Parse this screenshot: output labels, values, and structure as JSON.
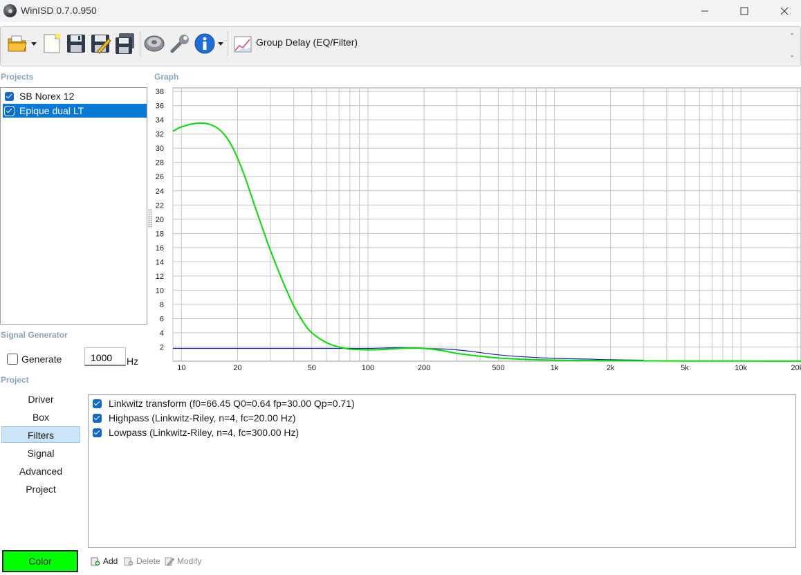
{
  "window": {
    "title": "WinISD 0.7.0.950",
    "controls": {
      "minimize": "—",
      "maximize": "☐",
      "close": "✕"
    }
  },
  "toolbar": {
    "icons": [
      "open-folder-icon",
      "new-document-icon",
      "save-icon",
      "save-as-icon",
      "save-all-icon",
      "driver-speaker-icon",
      "tools-wrench-icon",
      "info-icon"
    ],
    "graph_selector": {
      "label": "Group Delay (EQ/Filter)",
      "icon": "graph-chart-icon"
    },
    "dashes": [
      "-",
      "-"
    ]
  },
  "sections": {
    "projects": "Projects",
    "graph": "Graph",
    "signal_generator": "Signal Generator",
    "project": "Project"
  },
  "projects": [
    {
      "label": "SB Norex 12",
      "checked": true,
      "selected": false
    },
    {
      "label": "Epique dual LT",
      "checked": true,
      "selected": true
    }
  ],
  "signal_generator": {
    "generate_label": "Generate",
    "checked": false,
    "frequency": "1000",
    "unit": "Hz"
  },
  "nav": [
    {
      "label": "Driver",
      "active": false
    },
    {
      "label": "Box",
      "active": false
    },
    {
      "label": "Filters",
      "active": true
    },
    {
      "label": "Signal",
      "active": false
    },
    {
      "label": "Advanced",
      "active": false
    },
    {
      "label": "Project",
      "active": false
    }
  ],
  "color_button": {
    "label": "Color",
    "color": "#00ff00"
  },
  "filters": [
    {
      "label": "Linkwitz transform (f0=66.45 Q0=0.64 fp=30.00 Qp=0.71)",
      "checked": true
    },
    {
      "label": "Highpass (Linkwitz-Riley, n=4, fc=20.00 Hz)",
      "checked": true
    },
    {
      "label": "Lowpass (Linkwitz-Riley, n=4, fc=300.00 Hz)",
      "checked": true
    }
  ],
  "actions": [
    {
      "label": "Add",
      "enabled": true
    },
    {
      "label": "Delete",
      "enabled": false
    },
    {
      "label": "Modify",
      "enabled": false
    }
  ],
  "chart_data": {
    "type": "line",
    "title": "",
    "xlabel": "",
    "ylabel": "",
    "xscale": "log",
    "xlim": [
      9,
      21000
    ],
    "ylim": [
      0,
      38.5
    ],
    "grid": true,
    "legend": "none",
    "yticks": [
      2,
      4,
      6,
      8,
      10,
      12,
      14,
      16,
      18,
      20,
      22,
      24,
      26,
      28,
      30,
      32,
      34,
      36,
      38
    ],
    "xticks": [
      {
        "value": 10,
        "label": "10"
      },
      {
        "value": 20,
        "label": "20"
      },
      {
        "value": 50,
        "label": "50"
      },
      {
        "value": 100,
        "label": "100"
      },
      {
        "value": 200,
        "label": "200"
      },
      {
        "value": 500,
        "label": "500"
      },
      {
        "value": 1000,
        "label": "1k"
      },
      {
        "value": 2000,
        "label": "2k"
      },
      {
        "value": 5000,
        "label": "5k"
      },
      {
        "value": 10000,
        "label": "10k"
      },
      {
        "value": 20000,
        "label": "20k"
      }
    ],
    "series": [
      {
        "color": "#1a1ab4",
        "x": [
          9,
          20,
          40,
          60,
          80,
          100,
          150,
          200,
          300,
          500,
          700,
          1000,
          1500,
          2000,
          3000
        ],
        "y": [
          1.8,
          1.8,
          1.8,
          1.8,
          1.8,
          1.8,
          1.9,
          1.8,
          1.6,
          0.9,
          0.6,
          0.4,
          0.3,
          0.2,
          0.15
        ]
      },
      {
        "color": "#00e000",
        "x": [
          9,
          10,
          12,
          14,
          16,
          18,
          20,
          22,
          25,
          28,
          30,
          35,
          40,
          45,
          50,
          60,
          70,
          80,
          90,
          100,
          120,
          150,
          180,
          200,
          250,
          300,
          400,
          500,
          700,
          1000,
          2000,
          5000,
          10000,
          21000
        ],
        "y": [
          32.4,
          33.0,
          33.5,
          33.4,
          32.6,
          31.0,
          28.6,
          25.8,
          21.5,
          17.8,
          15.6,
          11.2,
          7.8,
          5.5,
          4.0,
          2.6,
          2.0,
          1.7,
          1.65,
          1.6,
          1.65,
          1.8,
          1.85,
          1.8,
          1.5,
          1.1,
          0.7,
          0.45,
          0.25,
          0.15,
          0.08,
          0.03,
          0.02,
          0.01
        ]
      }
    ]
  }
}
